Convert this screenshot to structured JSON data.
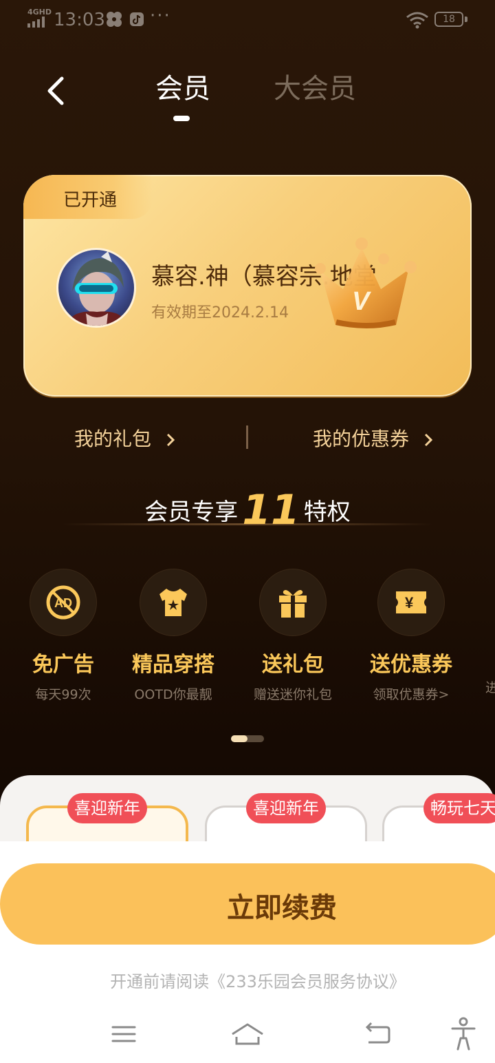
{
  "status_bar": {
    "network": "4GHD",
    "time": "13:03",
    "more": "···",
    "battery": "18"
  },
  "header": {
    "tabs": [
      {
        "label": "会员",
        "active": true
      },
      {
        "label": "大会员",
        "active": false
      }
    ]
  },
  "card": {
    "tag": "已开通",
    "username": "慕容.神（慕容宗.地堂",
    "validity": "有效期至2024.2.14"
  },
  "links": {
    "gift": "我的礼包",
    "coupon": "我的优惠券"
  },
  "section": {
    "prefix": "会员专享",
    "count": "11",
    "suffix": "特权"
  },
  "privileges": [
    {
      "title": "免广告",
      "desc": "每天99次",
      "icon": "no-ads-icon"
    },
    {
      "title": "精品穿搭",
      "desc": "OOTD你最靓",
      "icon": "tshirt-icon"
    },
    {
      "title": "送礼包",
      "desc": "赠送迷你礼包",
      "icon": "gift-icon"
    },
    {
      "title": "送优惠券",
      "desc": "领取优惠券>",
      "icon": "coupon-icon"
    },
    {
      "title": "",
      "desc": "进",
      "icon": ""
    }
  ],
  "plans": [
    {
      "badge": "喜迎新年"
    },
    {
      "badge": "喜迎新年"
    },
    {
      "badge": "畅玩七天"
    }
  ],
  "cta": {
    "label": "立即续费"
  },
  "agreement": "开通前请阅读《233乐园会员服务协议》",
  "colors": {
    "accent": "#fbc85a",
    "cta": "#fbc15a",
    "badge": "#f04f57"
  }
}
